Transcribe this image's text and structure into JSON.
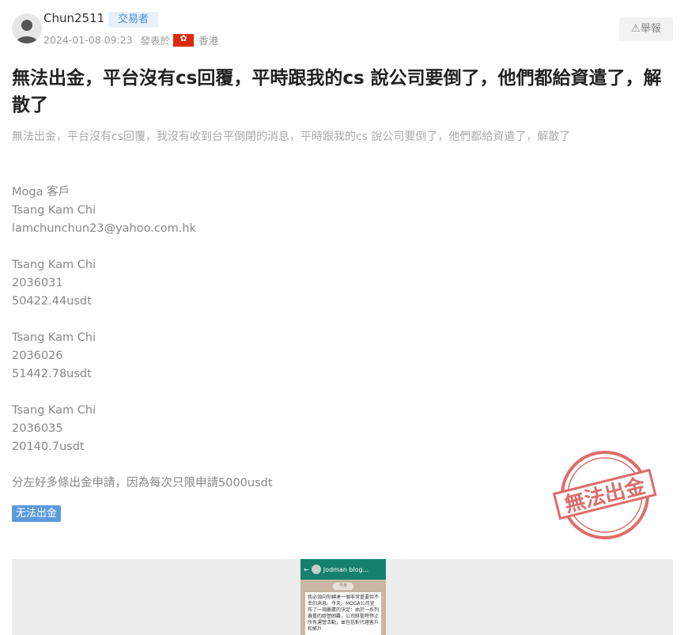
{
  "post": {
    "author": "Chun2511",
    "role": "交易者",
    "time": "2024-01-08 09:23",
    "posted_in_prefix": "發表於",
    "region": "香港",
    "report_label": "⚠舉報",
    "title": "無法出金，平台沒有cs回覆，平時跟我的cs 說公司要倒了，他們都給資遣了，解散了",
    "summary": "無法出金，平台沒有cs回覆，我沒有收到台平倒閉的消息，平時跟我的cs 說公司要倒了，他們都給資遣了，解散了"
  },
  "body": {
    "blocks": [
      [
        "Moga 客戶",
        "Tsang Kam Chi",
        "lamchunchun23@yahoo.com.hk"
      ],
      [
        "Tsang Kam Chi",
        "2036031",
        "50422.44usdt"
      ],
      [
        "Tsang Kam Chi",
        "2036026",
        "51442.78usdt"
      ],
      [
        "Tsang Kam Chi",
        "2036035",
        "20140.7usdt"
      ]
    ],
    "closing": "分左好多條出金申請，因為每次只限申請5000usdt"
  },
  "tag": "无法出金",
  "stamp": {
    "text": "無法出金",
    "color": "#d9534f"
  },
  "screenshot": {
    "chat_name": "Jodman blog...",
    "pill": "今天",
    "message": "我必須向你轉達一個非常重要但不幸的消息。今天，MOGA公司宣布了一項嚴肅的決定：由於一系列嚴重的經營困難，公司將暫時停止所有運營活動，並包括對代理客戶和帳戶"
  }
}
